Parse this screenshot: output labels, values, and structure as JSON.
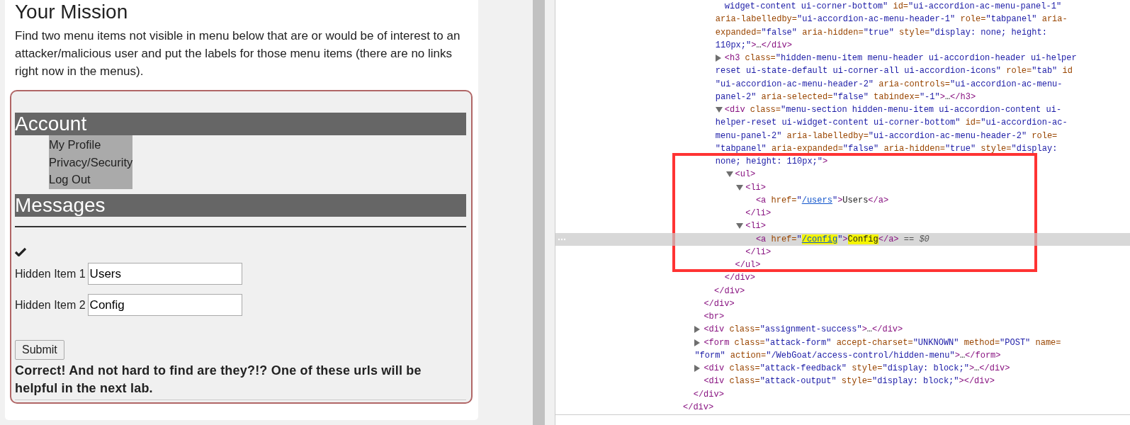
{
  "mission": {
    "title": "Your Mission",
    "description": "Find two menu items not visible in menu below that are or would be of interest to an attacker/malicious user and put the labels for those menu items (there are no links right now in the menus)."
  },
  "menu": {
    "sections": [
      {
        "title": "Account",
        "items": [
          "My Profile",
          "Privacy/Security",
          "Log Out"
        ]
      },
      {
        "title": "Messages"
      }
    ]
  },
  "form": {
    "fields": [
      {
        "label": "Hidden Item 1",
        "value": "Users"
      },
      {
        "label": "Hidden Item 2",
        "value": "Config"
      }
    ],
    "submit": "Submit",
    "feedback": "Correct! And not hard to find are they?!? One of these urls will be helpful in the next lab."
  },
  "devtools": {
    "dom_tree": [
      {
        "children": [
          {
            "children": [
              {
                "children": [
                  {
                    "children": [
                      {
                        "selected": false,
                        "lines": [
                          [
                            {
                              "kind": "val",
                              "text": "widget-content ui-corner-bottom\""
                            },
                            {
                              "kind": "attr",
                              "text": " id="
                            },
                            {
                              "kind": "val",
                              "text": "\"ui-accordion-ac-menu-panel-1\""
                            }
                          ],
                          [
                            {
                              "kind": "attr",
                              "text": "aria-labelledby="
                            },
                            {
                              "kind": "val",
                              "text": "\"ui-accordion-ac-menu-header-1\""
                            },
                            {
                              "kind": "attr",
                              "text": " role="
                            },
                            {
                              "kind": "val",
                              "text": "\"tabpanel\""
                            },
                            {
                              "kind": "attr",
                              "text": " aria-"
                            }
                          ],
                          [
                            {
                              "kind": "attr",
                              "text": "expanded="
                            },
                            {
                              "kind": "val",
                              "text": "\"false\""
                            },
                            {
                              "kind": "attr",
                              "text": " aria-hidden="
                            },
                            {
                              "kind": "val",
                              "text": "\"true\""
                            },
                            {
                              "kind": "attr",
                              "text": " style="
                            },
                            {
                              "kind": "val",
                              "text": "\"display: none; height:"
                            }
                          ],
                          [
                            {
                              "kind": "val",
                              "text": "110px;\""
                            },
                            {
                              "kind": "tag",
                              "text": ">"
                            },
                            {
                              "kind": "text",
                              "text": "…"
                            },
                            {
                              "kind": "tag",
                              "text": "</div>"
                            }
                          ]
                        ]
                      },
                      {
                        "selected": false,
                        "expanded": false,
                        "lines": [
                          [
                            {
                              "kind": "tag",
                              "text": "<h3"
                            },
                            {
                              "kind": "attr",
                              "text": " class="
                            },
                            {
                              "kind": "val",
                              "text": "\"hidden-menu-item menu-header ui-accordion-header ui-helper"
                            }
                          ],
                          [
                            {
                              "kind": "val",
                              "text": "reset ui-state-default ui-corner-all ui-accordion-icons\""
                            },
                            {
                              "kind": "attr",
                              "text": " role="
                            },
                            {
                              "kind": "val",
                              "text": "\"tab\""
                            },
                            {
                              "kind": "attr",
                              "text": " id"
                            }
                          ],
                          [
                            {
                              "kind": "val",
                              "text": "\"ui-accordion-ac-menu-header-2\""
                            },
                            {
                              "kind": "attr",
                              "text": " aria-controls="
                            },
                            {
                              "kind": "val",
                              "text": "\"ui-accordion-ac-menu-"
                            }
                          ],
                          [
                            {
                              "kind": "val",
                              "text": "panel-2\""
                            },
                            {
                              "kind": "attr",
                              "text": " aria-selected="
                            },
                            {
                              "kind": "val",
                              "text": "\"false\""
                            },
                            {
                              "kind": "attr",
                              "text": " tabindex="
                            },
                            {
                              "kind": "val",
                              "text": "\"-1\""
                            },
                            {
                              "kind": "tag",
                              "text": ">"
                            },
                            {
                              "kind": "text",
                              "text": "…"
                            },
                            {
                              "kind": "tag",
                              "text": "</h3>"
                            }
                          ]
                        ]
                      },
                      {
                        "selected": false,
                        "expanded": true,
                        "lines": [
                          [
                            {
                              "kind": "tag",
                              "text": "<div"
                            },
                            {
                              "kind": "attr",
                              "text": " class="
                            },
                            {
                              "kind": "val",
                              "text": "\"menu-section hidden-menu-item ui-accordion-content ui-"
                            }
                          ],
                          [
                            {
                              "kind": "val",
                              "text": "helper-reset ui-widget-content ui-corner-bottom\""
                            },
                            {
                              "kind": "attr",
                              "text": " id="
                            },
                            {
                              "kind": "val",
                              "text": "\"ui-accordion-ac-"
                            }
                          ],
                          [
                            {
                              "kind": "val",
                              "text": "menu-panel-2\""
                            },
                            {
                              "kind": "attr",
                              "text": " aria-labelledby="
                            },
                            {
                              "kind": "val",
                              "text": "\"ui-accordion-ac-menu-header-2\""
                            },
                            {
                              "kind": "attr",
                              "text": " role="
                            }
                          ],
                          [
                            {
                              "kind": "val",
                              "text": "\"tabpanel\""
                            },
                            {
                              "kind": "attr",
                              "text": " aria-expanded="
                            },
                            {
                              "kind": "val",
                              "text": "\"false\""
                            },
                            {
                              "kind": "attr",
                              "text": " aria-hidden="
                            },
                            {
                              "kind": "val",
                              "text": "\"true\""
                            },
                            {
                              "kind": "attr",
                              "text": " style="
                            },
                            {
                              "kind": "val",
                              "text": "\"display:"
                            }
                          ],
                          [
                            {
                              "kind": "val",
                              "text": "none; height: 110px;\""
                            },
                            {
                              "kind": "tag",
                              "text": ">"
                            }
                          ]
                        ],
                        "children": [
                          {
                            "selected": false,
                            "expanded": true,
                            "lines": [
                              [
                                {
                                  "kind": "tag",
                                  "text": "<ul>"
                                }
                              ]
                            ],
                            "children": [
                              {
                                "selected": false,
                                "expanded": true,
                                "lines": [
                                  [
                                    {
                                      "kind": "tag",
                                      "text": "<li>"
                                    }
                                  ]
                                ],
                                "children": [
                                  {
                                    "selected": false,
                                    "lines": [
                                      [
                                        {
                                          "kind": "tag",
                                          "text": "<a"
                                        },
                                        {
                                          "kind": "attr",
                                          "text": " href="
                                        },
                                        {
                                          "kind": "val",
                                          "text": "\""
                                        },
                                        {
                                          "kind": "link",
                                          "text": "/users"
                                        },
                                        {
                                          "kind": "val",
                                          "text": "\""
                                        },
                                        {
                                          "kind": "tag",
                                          "text": ">"
                                        },
                                        {
                                          "kind": "text",
                                          "text": "Users"
                                        },
                                        {
                                          "kind": "tag",
                                          "text": "</a>"
                                        }
                                      ]
                                    ]
                                  }
                                ],
                                "close": [
                                  {
                                    "kind": "tag",
                                    "text": "</li>"
                                  }
                                ]
                              },
                              {
                                "selected": false,
                                "expanded": true,
                                "lines": [
                                  [
                                    {
                                      "kind": "tag",
                                      "text": "<li>"
                                    }
                                  ]
                                ],
                                "children": [
                                  {
                                    "selected": true,
                                    "lines": [
                                      [
                                        {
                                          "kind": "tag",
                                          "text": "<a"
                                        },
                                        {
                                          "kind": "attr",
                                          "text": " href="
                                        },
                                        {
                                          "kind": "val",
                                          "text": "\""
                                        },
                                        {
                                          "kind": "match_link",
                                          "text": "/config"
                                        },
                                        {
                                          "kind": "val",
                                          "text": "\""
                                        },
                                        {
                                          "kind": "tag",
                                          "text": ">"
                                        },
                                        {
                                          "kind": "match",
                                          "text": "Config"
                                        },
                                        {
                                          "kind": "tag",
                                          "text": "</a>"
                                        },
                                        {
                                          "kind": "hint",
                                          "text": " == $0"
                                        }
                                      ]
                                    ]
                                  }
                                ],
                                "close": [
                                  {
                                    "kind": "tag",
                                    "text": "</li>"
                                  }
                                ]
                              }
                            ],
                            "close": [
                              {
                                "kind": "tag",
                                "text": "</ul>"
                              }
                            ]
                          }
                        ],
                        "close": [
                          {
                            "kind": "tag",
                            "text": "</div>"
                          }
                        ]
                      }
                    ],
                    "close": [
                      {
                        "kind": "tag",
                        "text": "</div>"
                      }
                    ]
                  }
                ],
                "close": [
                  {
                    "kind": "tag",
                    "text": "</div>"
                  }
                ]
              },
              {
                "selected": false,
                "lines": [
                  [
                    {
                      "kind": "tag",
                      "text": "<br>"
                    }
                  ]
                ]
              },
              {
                "selected": false,
                "expanded": false,
                "lines": [
                  [
                    {
                      "kind": "tag",
                      "text": "<div"
                    },
                    {
                      "kind": "attr",
                      "text": " class="
                    },
                    {
                      "kind": "val",
                      "text": "\"assignment-success\""
                    },
                    {
                      "kind": "tag",
                      "text": ">"
                    },
                    {
                      "kind": "text",
                      "text": "…"
                    },
                    {
                      "kind": "tag",
                      "text": "</div>"
                    }
                  ]
                ]
              },
              {
                "selected": false,
                "expanded": false,
                "lines": [
                  [
                    {
                      "kind": "tag",
                      "text": "<form"
                    },
                    {
                      "kind": "attr",
                      "text": " class="
                    },
                    {
                      "kind": "val",
                      "text": "\"attack-form\""
                    },
                    {
                      "kind": "attr",
                      "text": " accept-charset="
                    },
                    {
                      "kind": "val",
                      "text": "\"UNKNOWN\""
                    },
                    {
                      "kind": "attr",
                      "text": " method="
                    },
                    {
                      "kind": "val",
                      "text": "\"POST\""
                    },
                    {
                      "kind": "attr",
                      "text": " name="
                    }
                  ],
                  [
                    {
                      "kind": "val",
                      "text": "\"form\""
                    },
                    {
                      "kind": "attr",
                      "text": " action="
                    },
                    {
                      "kind": "val",
                      "text": "\"/WebGoat/access-control/hidden-menu\""
                    },
                    {
                      "kind": "tag",
                      "text": ">"
                    },
                    {
                      "kind": "text",
                      "text": "…"
                    },
                    {
                      "kind": "tag",
                      "text": "</form>"
                    }
                  ]
                ]
              },
              {
                "selected": false,
                "expanded": false,
                "lines": [
                  [
                    {
                      "kind": "tag",
                      "text": "<div"
                    },
                    {
                      "kind": "attr",
                      "text": " class="
                    },
                    {
                      "kind": "val",
                      "text": "\"attack-feedback\""
                    },
                    {
                      "kind": "attr",
                      "text": " style="
                    },
                    {
                      "kind": "val",
                      "text": "\"display: block;\""
                    },
                    {
                      "kind": "tag",
                      "text": ">"
                    },
                    {
                      "kind": "text",
                      "text": "…"
                    },
                    {
                      "kind": "tag",
                      "text": "</div>"
                    }
                  ]
                ]
              },
              {
                "selected": false,
                "lines": [
                  [
                    {
                      "kind": "tag",
                      "text": "<div"
                    },
                    {
                      "kind": "attr",
                      "text": " class="
                    },
                    {
                      "kind": "val",
                      "text": "\"attack-output\""
                    },
                    {
                      "kind": "attr",
                      "text": " style="
                    },
                    {
                      "kind": "val",
                      "text": "\"display: block;\""
                    },
                    {
                      "kind": "tag",
                      "text": ">"
                    },
                    {
                      "kind": "tag",
                      "text": "</div>"
                    }
                  ]
                ]
              }
            ],
            "close": [
              {
                "kind": "tag",
                "text": "</div>"
              }
            ]
          }
        ],
        "close": [
          {
            "kind": "tag",
            "text": "</div>"
          }
        ]
      }
    ]
  }
}
